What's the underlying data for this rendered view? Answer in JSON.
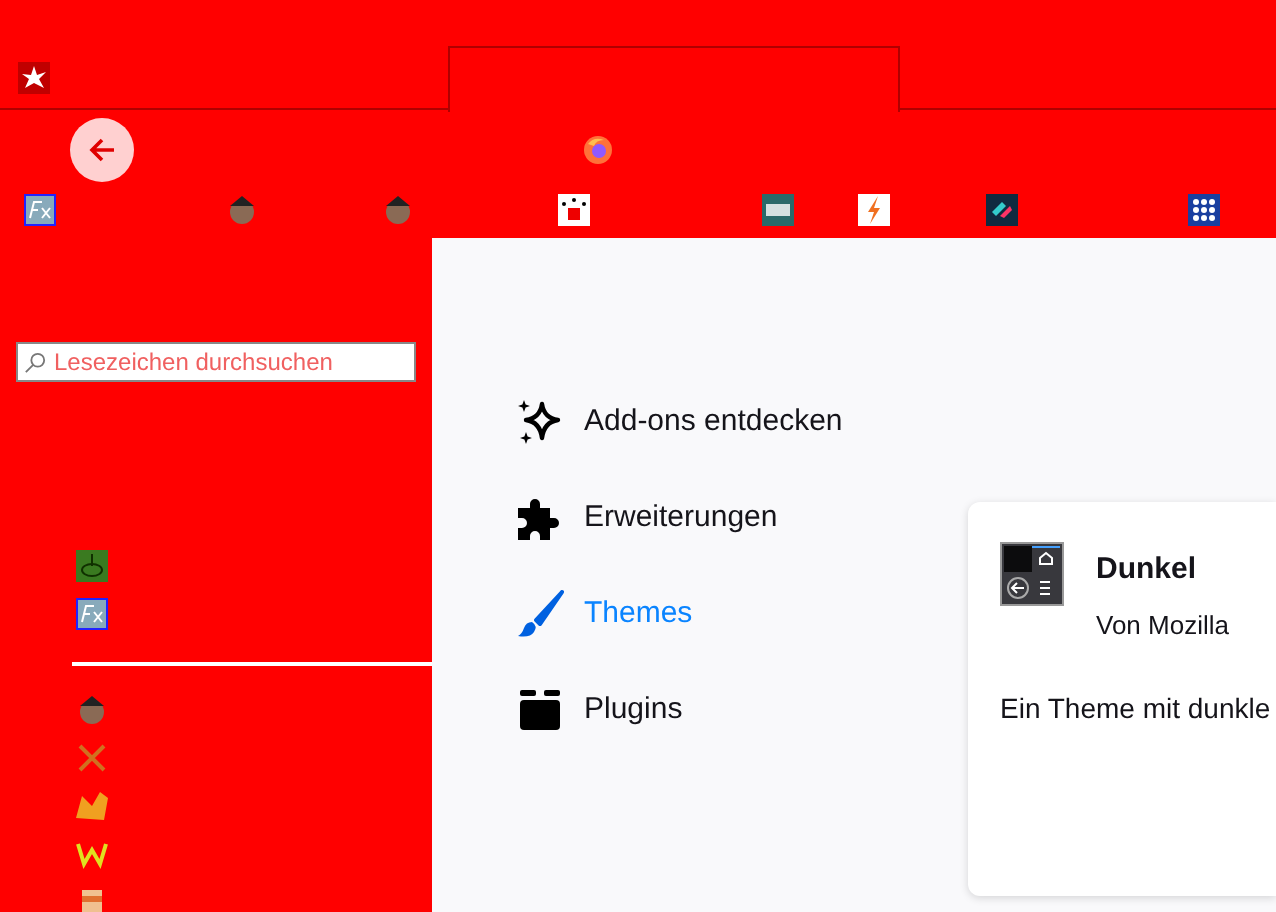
{
  "sidebar": {
    "search": {
      "placeholder": "Lesezeichen durchsuchen"
    }
  },
  "categories": [
    {
      "kind": "discover",
      "label": "Add-ons entdecken",
      "selected": false
    },
    {
      "kind": "extensions",
      "label": "Erweiterungen",
      "selected": false
    },
    {
      "kind": "themes",
      "label": "Themes",
      "selected": true
    },
    {
      "kind": "plugins",
      "label": "Plugins",
      "selected": false
    }
  ],
  "theme_card": {
    "name": "Dunkel",
    "author": "Von Mozilla",
    "description": "Ein Theme mit dunkle"
  }
}
